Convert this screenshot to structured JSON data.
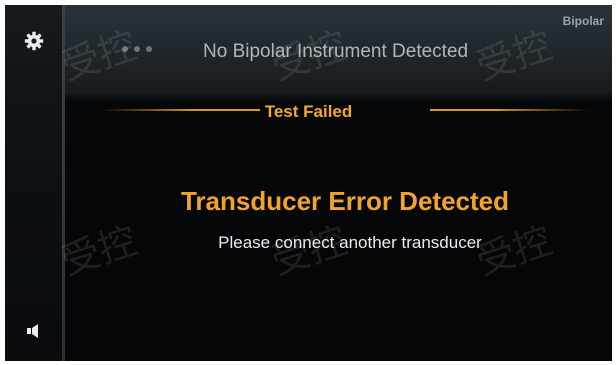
{
  "header": {
    "title": "No Bipolar Instrument Detected",
    "mode_label": "Bipolar",
    "more_icon": "more-dots-icon"
  },
  "sidebar": {
    "settings_icon": "gear-icon",
    "volume_icon": "speaker-icon"
  },
  "status": {
    "banner": "Test Failed",
    "error_title": "Transducer Error Detected",
    "error_message": "Please connect another transducer"
  },
  "watermark": {
    "text": "受控"
  },
  "colors": {
    "accent": "#f2a32a",
    "background": "#050607"
  }
}
